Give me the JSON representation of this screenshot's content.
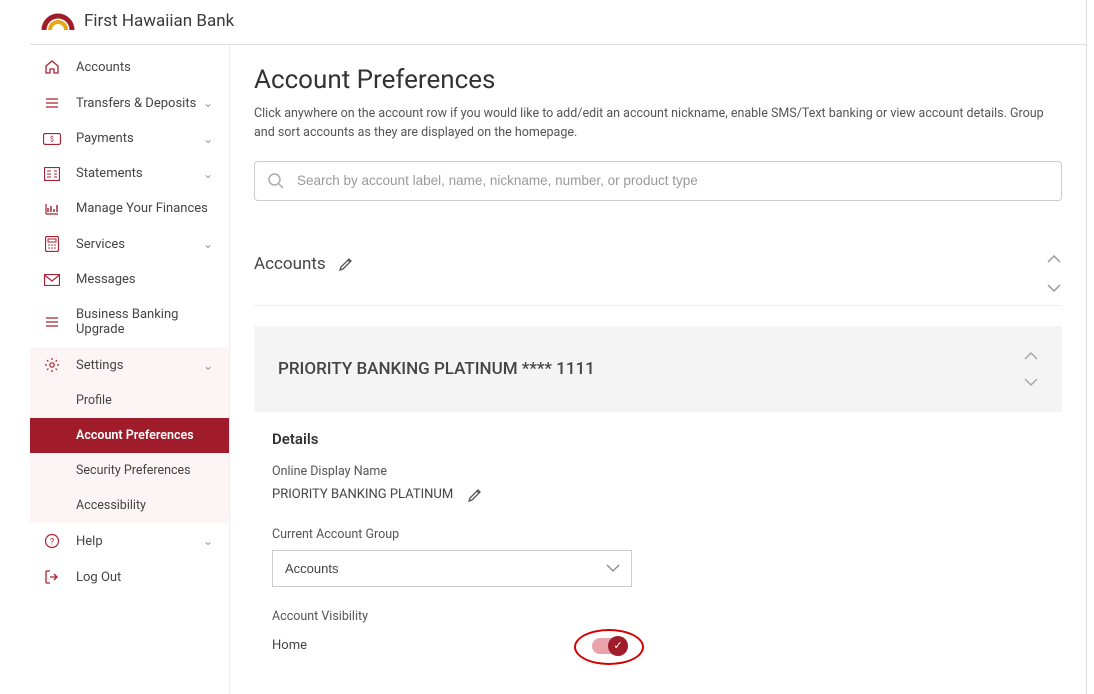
{
  "brand": {
    "name": "First Hawaiian Bank"
  },
  "sidebar": {
    "items": [
      {
        "label": "Accounts"
      },
      {
        "label": "Transfers & Deposits"
      },
      {
        "label": "Payments"
      },
      {
        "label": "Statements"
      },
      {
        "label": "Manage Your Finances"
      },
      {
        "label": "Services"
      },
      {
        "label": "Messages"
      },
      {
        "label": "Business Banking Upgrade"
      },
      {
        "label": "Settings"
      },
      {
        "label": "Help"
      },
      {
        "label": "Log Out"
      }
    ],
    "settings_sub": [
      {
        "label": "Profile"
      },
      {
        "label": "Account Preferences"
      },
      {
        "label": "Security Preferences"
      },
      {
        "label": "Accessibility"
      }
    ]
  },
  "page": {
    "title": "Account Preferences",
    "description": "Click anywhere on the account row if you would like to add/edit an account nickname, enable SMS/Text banking or view account details. Group and sort accounts as they are displayed on the homepage."
  },
  "search": {
    "placeholder": "Search by account label, name, nickname, number, or product type"
  },
  "section": {
    "title": "Accounts"
  },
  "account": {
    "title": "PRIORITY BANKING PLATINUM **** 1111",
    "details_heading": "Details",
    "display_name_label": "Online Display Name",
    "display_name_value": "PRIORITY BANKING PLATINUM",
    "group_label": "Current Account Group",
    "group_value": "Accounts",
    "visibility_label": "Account Visibility",
    "visibility_home": "Home"
  }
}
